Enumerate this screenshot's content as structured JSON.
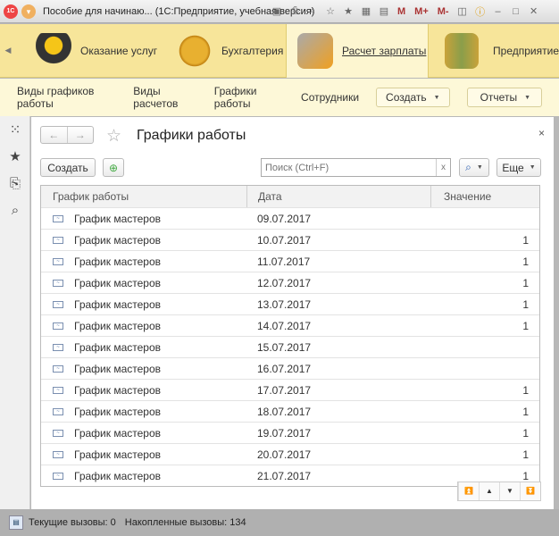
{
  "window": {
    "title": "Пособие для начинаю... (1С:Предприятие, учебная версия)",
    "memory": [
      "M",
      "M+",
      "M-"
    ]
  },
  "sections": [
    {
      "label": "Оказание услуг"
    },
    {
      "label": "Бухгалтерия"
    },
    {
      "label": "Расчет зарплаты"
    },
    {
      "label": "Предприятие"
    }
  ],
  "nav": {
    "links": [
      "Виды графиков работы",
      "Виды расчетов",
      "Графики работы",
      "Сотрудники"
    ],
    "create": "Создать",
    "reports": "Отчеты"
  },
  "form": {
    "title": "Графики работы",
    "create": "Создать",
    "search_placeholder": "Поиск (Ctrl+F)",
    "clear": "x",
    "more": "Еще",
    "close": "×"
  },
  "table": {
    "columns": [
      "График работы",
      "Дата",
      "Значение"
    ],
    "rows": [
      {
        "name": "График мастеров",
        "date": "09.07.2017",
        "value": ""
      },
      {
        "name": "График мастеров",
        "date": "10.07.2017",
        "value": "1"
      },
      {
        "name": "График мастеров",
        "date": "11.07.2017",
        "value": "1"
      },
      {
        "name": "График мастеров",
        "date": "12.07.2017",
        "value": "1"
      },
      {
        "name": "График мастеров",
        "date": "13.07.2017",
        "value": "1"
      },
      {
        "name": "График мастеров",
        "date": "14.07.2017",
        "value": "1"
      },
      {
        "name": "График мастеров",
        "date": "15.07.2017",
        "value": ""
      },
      {
        "name": "График мастеров",
        "date": "16.07.2017",
        "value": ""
      },
      {
        "name": "График мастеров",
        "date": "17.07.2017",
        "value": "1"
      },
      {
        "name": "График мастеров",
        "date": "18.07.2017",
        "value": "1"
      },
      {
        "name": "График мастеров",
        "date": "19.07.2017",
        "value": "1"
      },
      {
        "name": "График мастеров",
        "date": "20.07.2017",
        "value": "1"
      },
      {
        "name": "График мастеров",
        "date": "21.07.2017",
        "value": "1"
      }
    ]
  },
  "status": {
    "current": "Текущие вызовы: 0",
    "accumulated": "Накопленные вызовы: 134"
  }
}
